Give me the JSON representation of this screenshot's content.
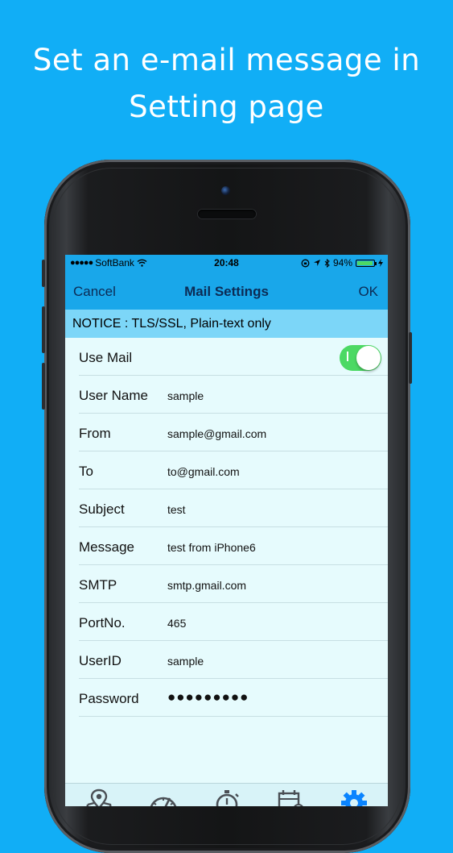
{
  "promo": {
    "line1": "Set an e-mail message in",
    "line2": "Setting page"
  },
  "status_bar": {
    "carrier": "SoftBank",
    "time": "20:48",
    "battery": "94%",
    "battery_level": 0.94
  },
  "nav": {
    "cancel": "Cancel",
    "title": "Mail Settings",
    "ok": "OK"
  },
  "notice": "NOTICE : TLS/SSL, Plain-text only",
  "settings": {
    "use_mail": {
      "label": "Use Mail",
      "enabled": true
    },
    "rows": [
      {
        "label": "User Name",
        "value": "sample"
      },
      {
        "label": "From",
        "value": "sample@gmail.com"
      },
      {
        "label": "To",
        "value": "to@gmail.com"
      },
      {
        "label": "Subject",
        "value": "test"
      },
      {
        "label": "Message",
        "value": "test from iPhone6"
      },
      {
        "label": "SMTP",
        "value": "smtp.gmail.com"
      },
      {
        "label": "PortNo.",
        "value": "465"
      },
      {
        "label": "UserID",
        "value": "sample"
      }
    ],
    "password": {
      "label": "Password",
      "value": "●●●●●●●●●"
    }
  },
  "tabs": [
    {
      "icon": "map-pin-icon"
    },
    {
      "icon": "speedometer-icon"
    },
    {
      "icon": "stopwatch-icon"
    },
    {
      "icon": "calendar-icon"
    },
    {
      "icon": "gear-icon",
      "active": true
    }
  ],
  "colors": {
    "background": "#11aef6",
    "nav": "#19a7ea",
    "notice": "#7cd6f8",
    "toggle_on": "#4cd964",
    "tab_active": "#0a84ff",
    "tab_inactive": "#4a4f55"
  }
}
